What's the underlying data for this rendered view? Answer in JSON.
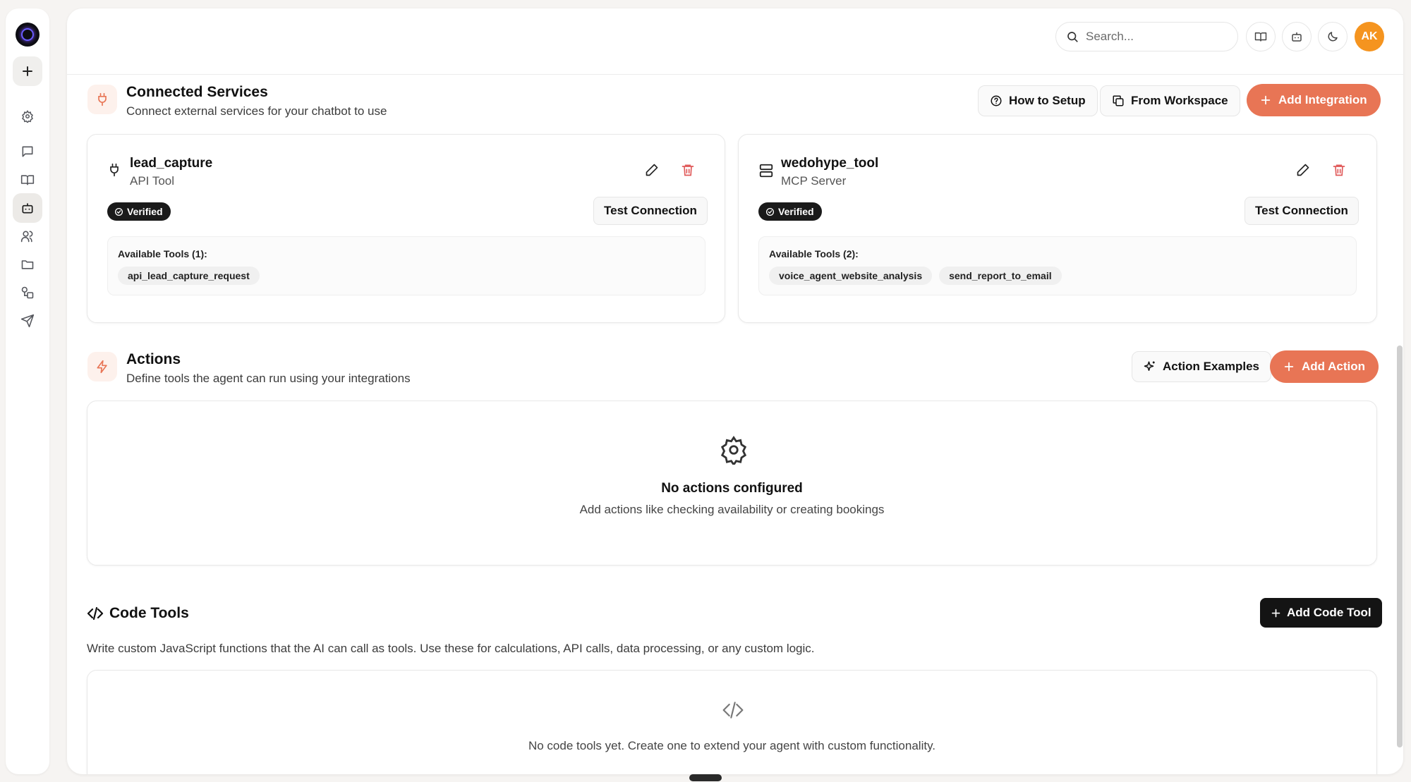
{
  "sidebar": {
    "items": [
      {
        "name": "new",
        "icon": "plus-icon"
      },
      {
        "name": "settings",
        "icon": "gear-icon"
      },
      {
        "name": "chats",
        "icon": "chat-icon"
      },
      {
        "name": "knowledge",
        "icon": "book-icon"
      },
      {
        "name": "bot",
        "icon": "bot-icon"
      },
      {
        "name": "users",
        "icon": "users-icon"
      },
      {
        "name": "files",
        "icon": "folder-icon"
      },
      {
        "name": "integrations",
        "icon": "shapes-icon"
      },
      {
        "name": "deploy",
        "icon": "send-icon"
      }
    ]
  },
  "header": {
    "search_placeholder": "Search...",
    "avatar_initials": "AK",
    "icons": [
      "book-icon",
      "bot-icon",
      "moon-icon"
    ]
  },
  "connected_services": {
    "title": "Connected Services",
    "subtitle": "Connect external services for your chatbot to use",
    "how_to_setup_label": "How to Setup",
    "from_workspace_label": "From Workspace",
    "add_integration_label": "Add Integration",
    "services": [
      {
        "name": "lead_capture",
        "type": "API Tool",
        "icon": "plug-icon",
        "status": "Verified",
        "test_label": "Test Connection",
        "tools_label": "Available Tools (1):",
        "tools": [
          "api_lead_capture_request"
        ]
      },
      {
        "name": "wedohype_tool",
        "type": "MCP Server",
        "icon": "server-icon",
        "status": "Verified",
        "test_label": "Test Connection",
        "tools_label": "Available Tools (2):",
        "tools": [
          "voice_agent_website_analysis",
          "send_report_to_email"
        ]
      }
    ]
  },
  "actions": {
    "title": "Actions",
    "subtitle": "Define tools the agent can run using your integrations",
    "examples_label": "Action Examples",
    "add_label": "Add Action",
    "empty_title": "No actions configured",
    "empty_sub": "Add actions like checking availability or creating bookings"
  },
  "code_tools": {
    "title": "Code Tools",
    "description": "Write custom JavaScript functions that the AI can call as tools. Use these for calculations, API calls, data processing, or any custom logic.",
    "add_label": "Add Code Tool",
    "empty_text": "No code tools yet. Create one to extend your agent with custom functionality."
  },
  "colors": {
    "accent": "#e87555",
    "avatar": "#f5941f",
    "delete": "#e05a5a",
    "dark_button": "#141414"
  }
}
